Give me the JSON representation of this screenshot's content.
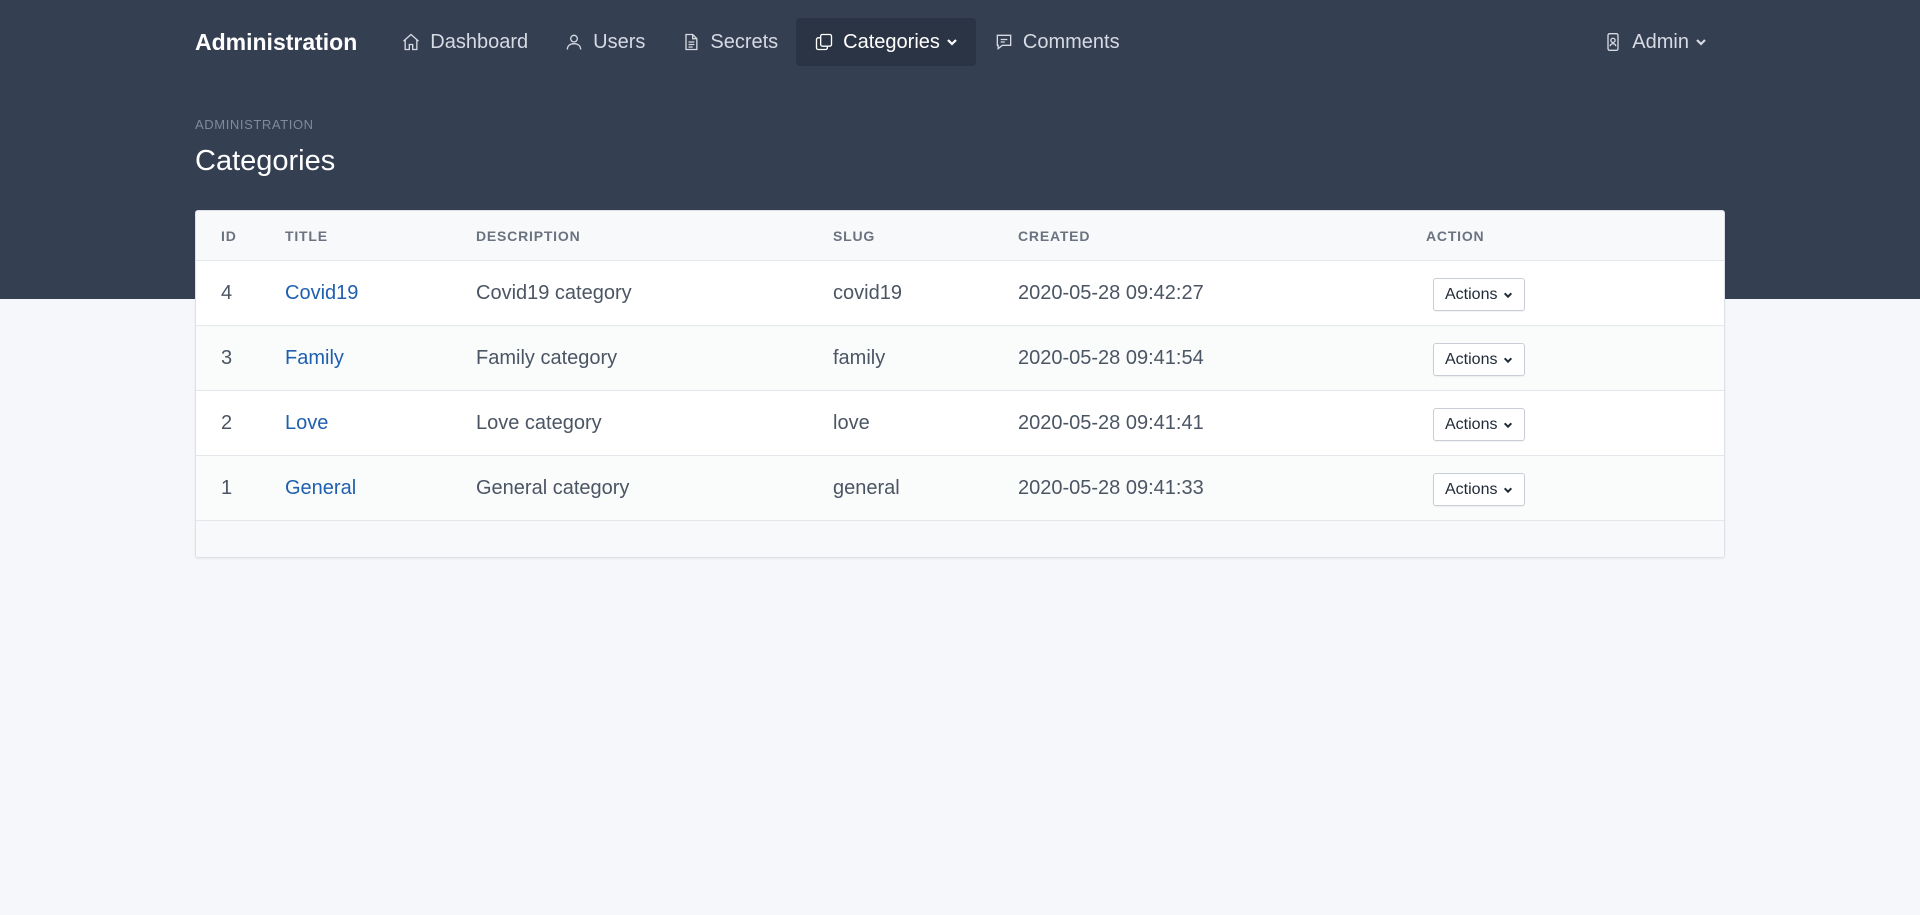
{
  "nav": {
    "brand": "Administration",
    "items": [
      {
        "label": "Dashboard",
        "icon": "home-icon"
      },
      {
        "label": "Users",
        "icon": "user-icon"
      },
      {
        "label": "Secrets",
        "icon": "document-icon"
      },
      {
        "label": "Categories",
        "icon": "copy-icon",
        "active": true
      },
      {
        "label": "Comments",
        "icon": "comment-icon"
      }
    ],
    "admin_label": "Admin"
  },
  "breadcrumb": "Administration",
  "page_title": "Categories",
  "table": {
    "headers": {
      "id": "ID",
      "title": "Title",
      "description": "Description",
      "slug": "Slug",
      "created": "Created",
      "action": "Action"
    },
    "rows": [
      {
        "id": "4",
        "title": "Covid19",
        "description": "Covid19 category",
        "slug": "covid19",
        "created": "2020-05-28 09:42:27",
        "action": "Actions"
      },
      {
        "id": "3",
        "title": "Family",
        "description": "Family category",
        "slug": "family",
        "created": "2020-05-28 09:41:54",
        "action": "Actions"
      },
      {
        "id": "2",
        "title": "Love",
        "description": "Love category",
        "slug": "love",
        "created": "2020-05-28 09:41:41",
        "action": "Actions"
      },
      {
        "id": "1",
        "title": "General",
        "description": "General category",
        "slug": "general",
        "created": "2020-05-28 09:41:33",
        "action": "Actions"
      }
    ]
  },
  "colors": {
    "header_bg": "#353f52",
    "link": "#1f5fb0",
    "page_bg": "#f5f7fa"
  }
}
